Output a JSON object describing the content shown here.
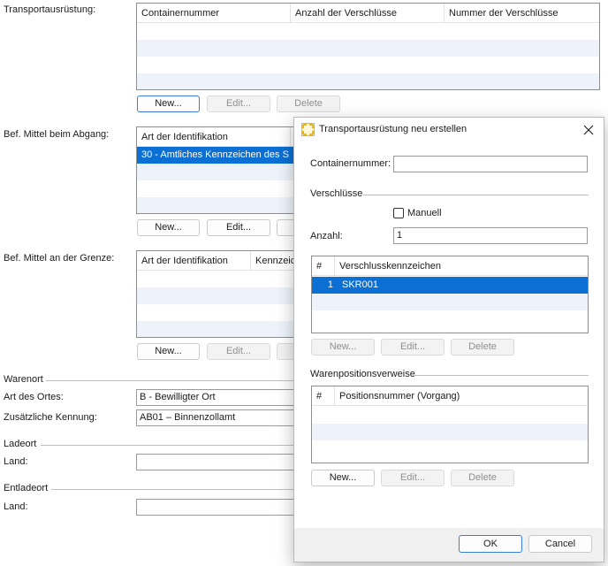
{
  "main": {
    "transport_label": "Transportausrüstung:",
    "transport_grid": {
      "columns": [
        "Containernummer",
        "Anzahl der Verschlüsse",
        "Nummer der Verschlüsse"
      ]
    },
    "transport_buttons": {
      "new": "New...",
      "edit": "Edit...",
      "delete": "Delete"
    },
    "abgang_label": "Bef. Mittel beim Abgang:",
    "abgang_grid": {
      "columns": [
        "Art der Identifikation"
      ],
      "rows": [
        "30 - Amtliches Kennzeichen des S..."
      ]
    },
    "abgang_buttons": {
      "new": "New...",
      "edit": "Edit..."
    },
    "grenze_label": "Bef. Mittel an der Grenze:",
    "grenze_grid": {
      "columns": [
        "Art der Identifikation",
        "Kennzeichen"
      ]
    },
    "grenze_buttons": {
      "new": "New...",
      "edit": "Edit..."
    },
    "warenort_section": "Warenort",
    "art_des_ortes_label": "Art des Ortes:",
    "art_des_ortes_value": "B - Bewilligter Ort",
    "zus_kennung_label": "Zusätzliche Kennung:",
    "zus_kennung_value": "AB01 – Binnenzollamt",
    "ladeort_section": "Ladeort",
    "ladeort_land_label": "Land:",
    "entladeort_section": "Entladeort",
    "entladeort_land_label": "Land:"
  },
  "dialog": {
    "title": "Transportausrüstung neu erstellen",
    "containernummer_label": "Containernummer:",
    "containernummer_value": "",
    "verschluesse_section": "Verschlüsse",
    "manuell_label": "Manuell",
    "manuell_checked": false,
    "anzahl_label": "Anzahl:",
    "anzahl_value": "1",
    "seal_grid": {
      "col_num": "#",
      "col_name": "Verschlusskennzeichen",
      "rows": [
        {
          "num": "1",
          "value": "SKR001"
        }
      ]
    },
    "seal_buttons": {
      "new": "New...",
      "edit": "Edit...",
      "delete": "Delete"
    },
    "waren_section": "Warenpositionsverweise",
    "pos_grid": {
      "col_num": "#",
      "col_name": "Positionsnummer (Vorgang)"
    },
    "pos_buttons": {
      "new": "New...",
      "edit": "Edit...",
      "delete": "Delete"
    },
    "ok_label": "OK",
    "cancel_label": "Cancel"
  },
  "colors": {
    "selection": "#0b6fd3",
    "alt_row": "#eef3fb",
    "accent": "#3c7ed0",
    "icon": "#f2b705"
  }
}
